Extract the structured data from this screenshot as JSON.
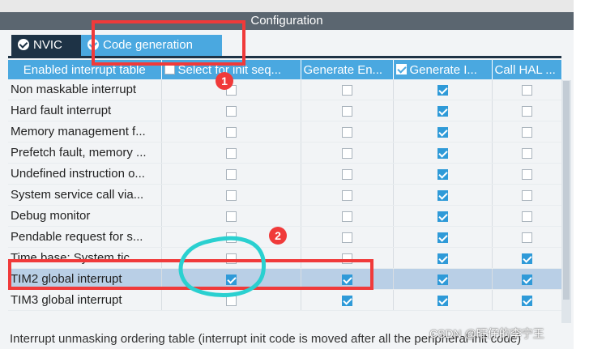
{
  "window": {
    "title": "Configuration"
  },
  "tabs": [
    {
      "label": "NVIC",
      "active": false
    },
    {
      "label": "Code generation",
      "active": true
    }
  ],
  "table": {
    "columns": [
      {
        "label": "Enabled interrupt table",
        "checked": null
      },
      {
        "label": "Select for init seq...",
        "checked": false
      },
      {
        "label": "Generate En...",
        "checked": null
      },
      {
        "label": "Generate I...",
        "checked": true
      },
      {
        "label": "Call HAL ...",
        "checked": null
      }
    ],
    "rows": [
      {
        "name": "Non maskable interrupt",
        "checks": [
          false,
          false,
          true,
          false
        ]
      },
      {
        "name": "Hard fault interrupt",
        "checks": [
          false,
          false,
          true,
          false
        ]
      },
      {
        "name": "Memory management f...",
        "checks": [
          false,
          false,
          true,
          false
        ]
      },
      {
        "name": "Prefetch fault, memory ...",
        "checks": [
          false,
          false,
          true,
          false
        ]
      },
      {
        "name": "Undefined instruction o...",
        "checks": [
          false,
          false,
          true,
          false
        ]
      },
      {
        "name": "System service call via...",
        "checks": [
          false,
          false,
          true,
          false
        ]
      },
      {
        "name": "Debug monitor",
        "checks": [
          false,
          false,
          true,
          false
        ]
      },
      {
        "name": "Pendable request for s...",
        "checks": [
          false,
          false,
          true,
          false
        ]
      },
      {
        "name": "Time base: System tic...",
        "checks": [
          false,
          false,
          true,
          true
        ]
      },
      {
        "name": "TIM2 global interrupt",
        "checks": [
          true,
          true,
          true,
          true
        ],
        "selected": true
      },
      {
        "name": "TIM3 global interrupt",
        "checks": [
          false,
          true,
          true,
          true
        ]
      }
    ]
  },
  "footer_text": "Interrupt unmasking ordering table (interrupt init code is moved after all the peripheral init code)",
  "watermark": "CSDN @旺仔的李宁王",
  "annotations": {
    "badge1": "1",
    "badge2": "2"
  },
  "colors": {
    "header_blue": "#4aa8e0",
    "tab_dark": "#1e3346",
    "annotation_red": "#f03a3a",
    "circle_cyan": "#2ad0d0"
  }
}
